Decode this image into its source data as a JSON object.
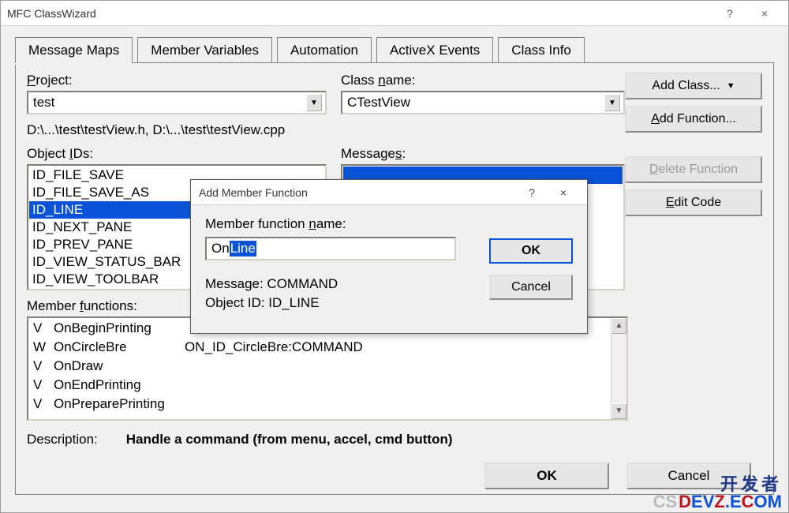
{
  "main": {
    "title": "MFC ClassWizard",
    "help": "?",
    "close": "×"
  },
  "tabs": [
    "Message Maps",
    "Member Variables",
    "Automation",
    "ActiveX Events",
    "Class Info"
  ],
  "labels": {
    "project": "Project:",
    "project_hint": "P",
    "className": "Class name:",
    "className_hint": "n",
    "objectIds": "Object IDs:",
    "objectIds_hint": "I",
    "messages": "Messages:",
    "messages_hint": "s",
    "memberFunctions": "Member functions:",
    "memberFunctions_hint": "f",
    "description": "Description:"
  },
  "project": "test",
  "classNameValue": "CTestView",
  "pathText": "D:\\...\\test\\testView.h, D:\\...\\test\\testView.cpp",
  "objectIds": [
    "ID_FILE_SAVE",
    "ID_FILE_SAVE_AS",
    "ID_LINE",
    "ID_NEXT_PANE",
    "ID_PREV_PANE",
    "ID_VIEW_STATUS_BAR",
    "ID_VIEW_TOOLBAR"
  ],
  "objectIdsSelected": 2,
  "memberFns": [
    {
      "v": "V",
      "name": "OnBeginPrinting",
      "msg": ""
    },
    {
      "v": "W",
      "name": "OnCircleBre",
      "msg": "ON_ID_CircleBre:COMMAND"
    },
    {
      "v": "V",
      "name": "OnDraw",
      "msg": ""
    },
    {
      "v": "V",
      "name": "OnEndPrinting",
      "msg": ""
    },
    {
      "v": "V",
      "name": "OnPreparePrinting",
      "msg": ""
    }
  ],
  "descriptionText": "Handle a command (from menu, accel, cmd button)",
  "rightButtons": {
    "addClass": "Add Class...",
    "addFunction": "Add Function...",
    "addFunction_hint": "A",
    "deleteFunction": "Delete Function",
    "deleteFunction_hint": "D",
    "editCode": "Edit Code",
    "editCode_hint": "E"
  },
  "bottom": {
    "ok": "OK",
    "cancel": "Cancel"
  },
  "dialog": {
    "title": "Add Member Function",
    "help": "?",
    "close": "×",
    "memberLabel": "Member function name:",
    "memberLabel_hint": "n",
    "inputPrefix": "On",
    "inputSelected": "Line",
    "messageLine": "Message: COMMAND",
    "objectLine": "Object ID: ID_LINE",
    "ok": "OK",
    "cancel": "Cancel"
  },
  "watermark": {
    "top": "开发者",
    "cs": "CS",
    "d": "D",
    "ev": "EV",
    "z": "Z",
    "dot": ".",
    "c": "E",
    "o": "C",
    "m": "OM"
  }
}
